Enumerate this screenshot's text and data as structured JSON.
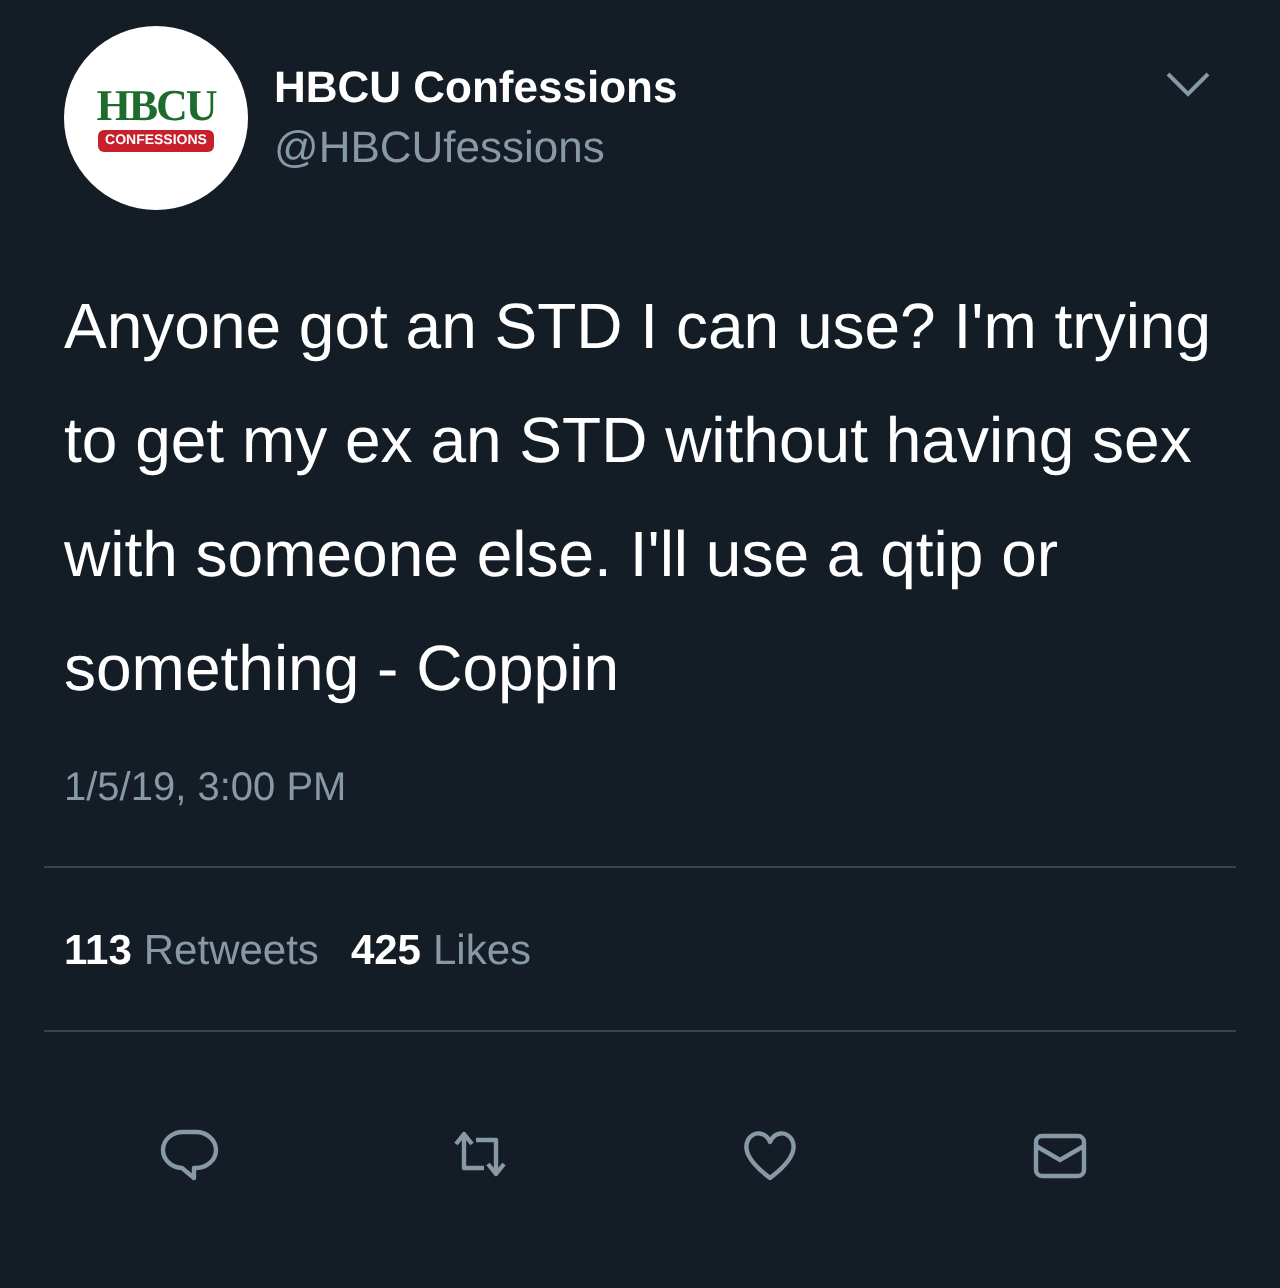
{
  "account": {
    "name": "HBCU Confessions",
    "handle": "@HBCUfessions",
    "avatar": {
      "logo_text": "HBCU",
      "banner_text": "CONFESSIONS"
    }
  },
  "tweet": {
    "text": "Anyone got an STD I can use? I'm trying to get my ex an STD without having sex with someone else. I'll use a qtip or something - Coppin",
    "timestamp": "1/5/19, 3:00 PM"
  },
  "stats": [
    {
      "count": "113",
      "label": "Retweets"
    },
    {
      "count": "425",
      "label": "Likes"
    }
  ],
  "actions": [
    {
      "kind": "reply"
    },
    {
      "kind": "retweet"
    },
    {
      "kind": "like"
    },
    {
      "kind": "message"
    }
  ]
}
